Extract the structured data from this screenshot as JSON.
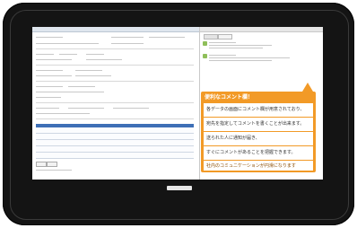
{
  "callout": {
    "title": "便利なコメント欄！",
    "lines": [
      "各データの画面にコメント欄が用意されており、",
      "宛先を指定してコメントを書くことが出来ます。",
      "送られた人に通知が届き、",
      "すぐにコメントがあることを把握できます。",
      "社内のコミュニケーションが円滑になります"
    ]
  },
  "colors": {
    "accent": "#f29a27",
    "table_header": "#3e6fb6",
    "avatar": "#8fbf5a"
  },
  "icons": [
    "home-button"
  ]
}
